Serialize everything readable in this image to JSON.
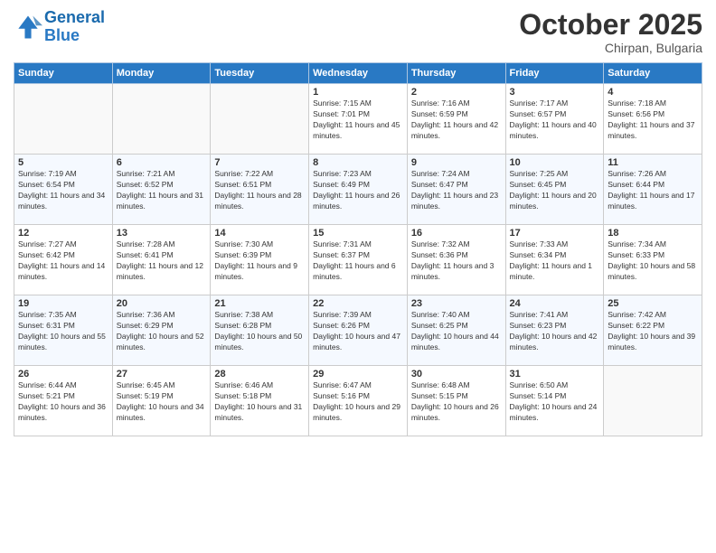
{
  "header": {
    "logo_line1": "General",
    "logo_line2": "Blue",
    "month": "October 2025",
    "location": "Chirpan, Bulgaria"
  },
  "days_of_week": [
    "Sunday",
    "Monday",
    "Tuesday",
    "Wednesday",
    "Thursday",
    "Friday",
    "Saturday"
  ],
  "weeks": [
    [
      {
        "num": "",
        "info": ""
      },
      {
        "num": "",
        "info": ""
      },
      {
        "num": "",
        "info": ""
      },
      {
        "num": "1",
        "info": "Sunrise: 7:15 AM\nSunset: 7:01 PM\nDaylight: 11 hours and 45 minutes."
      },
      {
        "num": "2",
        "info": "Sunrise: 7:16 AM\nSunset: 6:59 PM\nDaylight: 11 hours and 42 minutes."
      },
      {
        "num": "3",
        "info": "Sunrise: 7:17 AM\nSunset: 6:57 PM\nDaylight: 11 hours and 40 minutes."
      },
      {
        "num": "4",
        "info": "Sunrise: 7:18 AM\nSunset: 6:56 PM\nDaylight: 11 hours and 37 minutes."
      }
    ],
    [
      {
        "num": "5",
        "info": "Sunrise: 7:19 AM\nSunset: 6:54 PM\nDaylight: 11 hours and 34 minutes."
      },
      {
        "num": "6",
        "info": "Sunrise: 7:21 AM\nSunset: 6:52 PM\nDaylight: 11 hours and 31 minutes."
      },
      {
        "num": "7",
        "info": "Sunrise: 7:22 AM\nSunset: 6:51 PM\nDaylight: 11 hours and 28 minutes."
      },
      {
        "num": "8",
        "info": "Sunrise: 7:23 AM\nSunset: 6:49 PM\nDaylight: 11 hours and 26 minutes."
      },
      {
        "num": "9",
        "info": "Sunrise: 7:24 AM\nSunset: 6:47 PM\nDaylight: 11 hours and 23 minutes."
      },
      {
        "num": "10",
        "info": "Sunrise: 7:25 AM\nSunset: 6:45 PM\nDaylight: 11 hours and 20 minutes."
      },
      {
        "num": "11",
        "info": "Sunrise: 7:26 AM\nSunset: 6:44 PM\nDaylight: 11 hours and 17 minutes."
      }
    ],
    [
      {
        "num": "12",
        "info": "Sunrise: 7:27 AM\nSunset: 6:42 PM\nDaylight: 11 hours and 14 minutes."
      },
      {
        "num": "13",
        "info": "Sunrise: 7:28 AM\nSunset: 6:41 PM\nDaylight: 11 hours and 12 minutes."
      },
      {
        "num": "14",
        "info": "Sunrise: 7:30 AM\nSunset: 6:39 PM\nDaylight: 11 hours and 9 minutes."
      },
      {
        "num": "15",
        "info": "Sunrise: 7:31 AM\nSunset: 6:37 PM\nDaylight: 11 hours and 6 minutes."
      },
      {
        "num": "16",
        "info": "Sunrise: 7:32 AM\nSunset: 6:36 PM\nDaylight: 11 hours and 3 minutes."
      },
      {
        "num": "17",
        "info": "Sunrise: 7:33 AM\nSunset: 6:34 PM\nDaylight: 11 hours and 1 minute."
      },
      {
        "num": "18",
        "info": "Sunrise: 7:34 AM\nSunset: 6:33 PM\nDaylight: 10 hours and 58 minutes."
      }
    ],
    [
      {
        "num": "19",
        "info": "Sunrise: 7:35 AM\nSunset: 6:31 PM\nDaylight: 10 hours and 55 minutes."
      },
      {
        "num": "20",
        "info": "Sunrise: 7:36 AM\nSunset: 6:29 PM\nDaylight: 10 hours and 52 minutes."
      },
      {
        "num": "21",
        "info": "Sunrise: 7:38 AM\nSunset: 6:28 PM\nDaylight: 10 hours and 50 minutes."
      },
      {
        "num": "22",
        "info": "Sunrise: 7:39 AM\nSunset: 6:26 PM\nDaylight: 10 hours and 47 minutes."
      },
      {
        "num": "23",
        "info": "Sunrise: 7:40 AM\nSunset: 6:25 PM\nDaylight: 10 hours and 44 minutes."
      },
      {
        "num": "24",
        "info": "Sunrise: 7:41 AM\nSunset: 6:23 PM\nDaylight: 10 hours and 42 minutes."
      },
      {
        "num": "25",
        "info": "Sunrise: 7:42 AM\nSunset: 6:22 PM\nDaylight: 10 hours and 39 minutes."
      }
    ],
    [
      {
        "num": "26",
        "info": "Sunrise: 6:44 AM\nSunset: 5:21 PM\nDaylight: 10 hours and 36 minutes."
      },
      {
        "num": "27",
        "info": "Sunrise: 6:45 AM\nSunset: 5:19 PM\nDaylight: 10 hours and 34 minutes."
      },
      {
        "num": "28",
        "info": "Sunrise: 6:46 AM\nSunset: 5:18 PM\nDaylight: 10 hours and 31 minutes."
      },
      {
        "num": "29",
        "info": "Sunrise: 6:47 AM\nSunset: 5:16 PM\nDaylight: 10 hours and 29 minutes."
      },
      {
        "num": "30",
        "info": "Sunrise: 6:48 AM\nSunset: 5:15 PM\nDaylight: 10 hours and 26 minutes."
      },
      {
        "num": "31",
        "info": "Sunrise: 6:50 AM\nSunset: 5:14 PM\nDaylight: 10 hours and 24 minutes."
      },
      {
        "num": "",
        "info": ""
      }
    ]
  ]
}
